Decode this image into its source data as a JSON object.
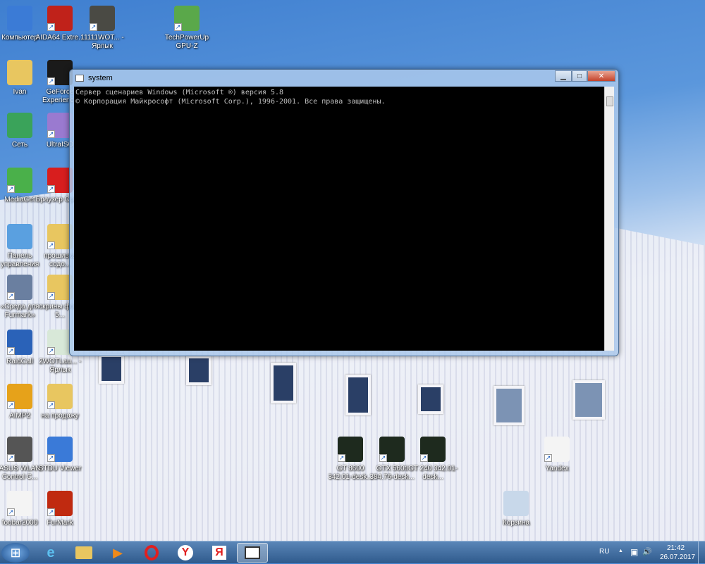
{
  "desktop": {
    "icons": [
      {
        "label": "Компьютер",
        "color": "#3b7bd6"
      },
      {
        "label": "Ivan",
        "color": "#e8c660"
      },
      {
        "label": "Сеть",
        "color": "#3aa35a"
      },
      {
        "label": "MediaGet",
        "color": "#4ab04a"
      },
      {
        "label": "Панель управления",
        "color": "#5aa0e0"
      },
      {
        "label": "«Среда для Furmark»",
        "color": "#6a7fa0"
      },
      {
        "label": "RaidCall",
        "color": "#2a62b8"
      },
      {
        "label": "AIMP2",
        "color": "#e6a21a"
      },
      {
        "label": "ASUS WLAN Control C...",
        "color": "#555555"
      },
      {
        "label": "foobar2000",
        "color": "#f4f4f4"
      },
      {
        "label": "AIDA64 Extre...",
        "color": "#c0221a"
      },
      {
        "label": "GeForce Experience",
        "color": "#1a1a1a"
      },
      {
        "label": "UltraISO",
        "color": "#9a7ad0"
      },
      {
        "label": "Браузер Opera",
        "color": "#d81e1e"
      },
      {
        "label": "прошивка содо...",
        "color": "#e8c660"
      },
      {
        "label": "скрины фото 5...",
        "color": "#e8c660"
      },
      {
        "label": "2WOTLau... - Ярлык",
        "color": "#d8e8d8"
      },
      {
        "label": "на продажу",
        "color": "#e8c660"
      },
      {
        "label": "STDU Viewer",
        "color": "#3a7ad8"
      },
      {
        "label": "FurMark",
        "color": "#c02a10"
      },
      {
        "label": "11111WOT... - Ярлык",
        "color": "#4a4a44"
      },
      {
        "label": "TechPowerUp GPU-Z",
        "color": "#5aa84a"
      },
      {
        "label": "GT 8600 342.01-desk...",
        "color": "#1e2a1e"
      },
      {
        "label": "GTX 560ti 384.76-desk...",
        "color": "#1e2a1e"
      },
      {
        "label": "GT 240 342.01-desk...",
        "color": "#1e2a1e"
      },
      {
        "label": "Yandex",
        "color": "#f4f4f4"
      },
      {
        "label": "Корзина",
        "color": "#c8d8ea"
      }
    ]
  },
  "console": {
    "title": "system",
    "lines": [
      "Сервер сценариев Windows (Microsoft ®) версия 5.8",
      "© Корпорация Майкрософт (Microsoft Corp.), 1996-2001. Все права защищены."
    ],
    "minimize": "▁",
    "maximize": "□",
    "close": "✕"
  },
  "taskbar": {
    "start": "⊞",
    "apps": [
      "IE",
      "Explorer",
      "Media Player",
      "Opera",
      "Yandex",
      "Яндекс",
      "system"
    ],
    "lang": "RU",
    "time": "21:42",
    "date": "26.07.2017",
    "show_hidden": "▲",
    "volume": "🔊",
    "network": "▣"
  }
}
